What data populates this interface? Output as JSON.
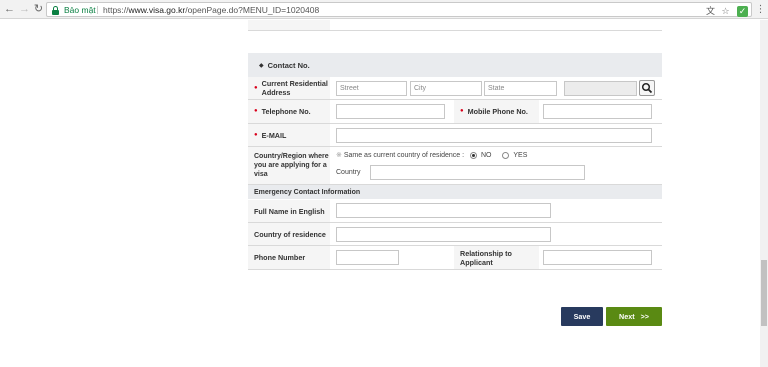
{
  "browser": {
    "secure_label": "Bảo mật",
    "url_scheme": "https://",
    "url_host": "www.visa.go.kr",
    "url_path": "/openPage.do?MENU_ID=1020408"
  },
  "contact": {
    "section_title": "Contact No.",
    "address_label": "Current Residential Address",
    "street_placeholder": "Street",
    "city_placeholder": "City",
    "state_placeholder": "State",
    "telephone_label": "Telephone No.",
    "mobile_label": "Mobile Phone No.",
    "email_label": "E-MAIL",
    "country_region_label": "Country/Region where you are applying for a visa",
    "same_as_text": "Same as current country of residence :",
    "no_label": "NO",
    "yes_label": "YES",
    "selected": "NO",
    "country_label": "Country"
  },
  "emergency": {
    "section_title": "Emergency Contact Information",
    "full_name_label": "Full Name in English",
    "country_label": "Country of residence",
    "phone_label": "Phone Number",
    "relationship_label": "Relationship to Applicant"
  },
  "actions": {
    "save_label": "Save",
    "next_label": "Next   >>"
  },
  "colors": {
    "save_bg": "#283a5e",
    "next_bg": "#5a8a13",
    "required": "#d9001b"
  }
}
